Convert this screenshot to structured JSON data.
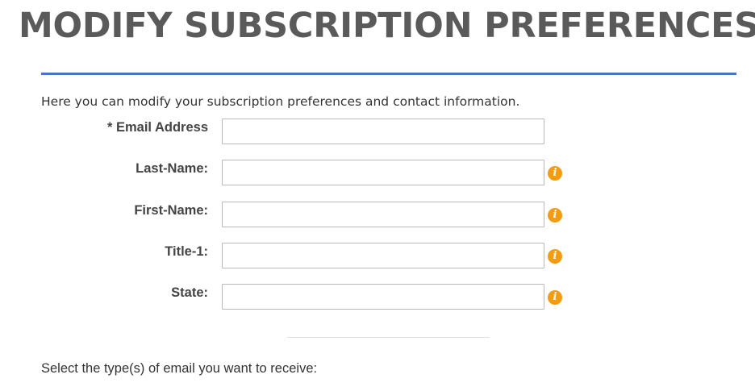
{
  "header": {
    "title": "MODIFY SUBSCRIPTION PREFERENCES"
  },
  "intro": "Here you can modify your subscription preferences and contact information.",
  "colors": {
    "title_text": "#5a5a5a",
    "rule_accent": "#4a72c8",
    "info_icon": "#f39c12"
  },
  "form": {
    "fields": [
      {
        "label": "* Email Address",
        "value": "",
        "placeholder": "",
        "icon": ""
      },
      {
        "label": "Last-Name:",
        "value": "",
        "placeholder": "",
        "icon": "info-icon"
      },
      {
        "label": "First-Name:",
        "value": "",
        "placeholder": "",
        "icon": "info-icon"
      },
      {
        "label": "Title-1:",
        "value": "",
        "placeholder": "",
        "icon": "info-icon"
      },
      {
        "label": "State:",
        "value": "",
        "placeholder": "",
        "icon": "info-icon"
      }
    ]
  },
  "email_types": {
    "prompt": "Select the type(s) of email you want to receive:"
  }
}
